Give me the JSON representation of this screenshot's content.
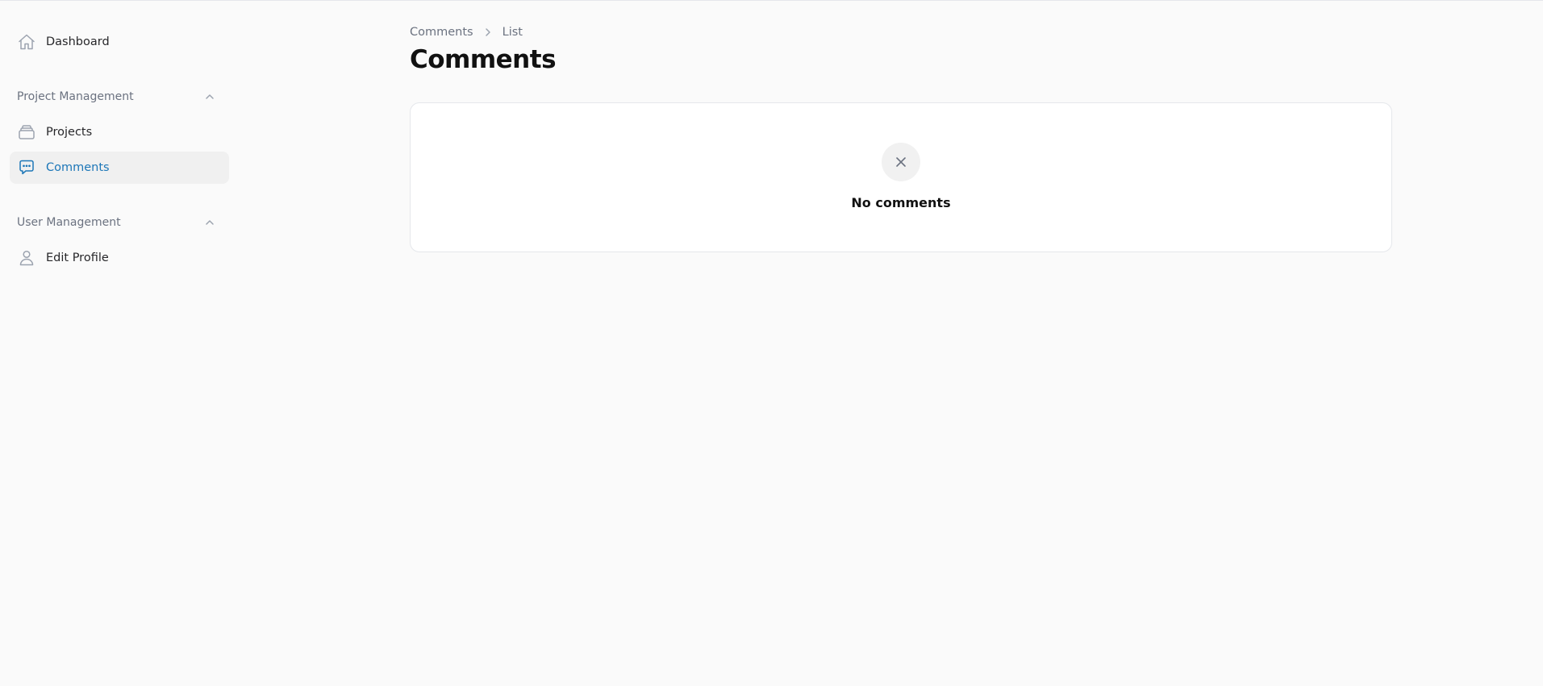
{
  "sidebar": {
    "dashboard_label": "Dashboard",
    "groups": [
      {
        "label": "Project Management",
        "items": [
          {
            "label": "Projects",
            "icon": "archive-icon",
            "active": false
          },
          {
            "label": "Comments",
            "icon": "chat-bubble-icon",
            "active": true
          }
        ]
      },
      {
        "label": "User Management",
        "items": [
          {
            "label": "Edit Profile",
            "icon": "user-icon",
            "active": false
          }
        ]
      }
    ]
  },
  "breadcrumb": {
    "items": [
      "Comments",
      "List"
    ]
  },
  "page": {
    "title": "Comments"
  },
  "empty_state": {
    "icon": "x-icon",
    "text": "No comments"
  },
  "colors": {
    "accent": "#1d77b8",
    "background": "#fafafa",
    "card": "#ffffff",
    "muted_text": "#6b7280"
  }
}
